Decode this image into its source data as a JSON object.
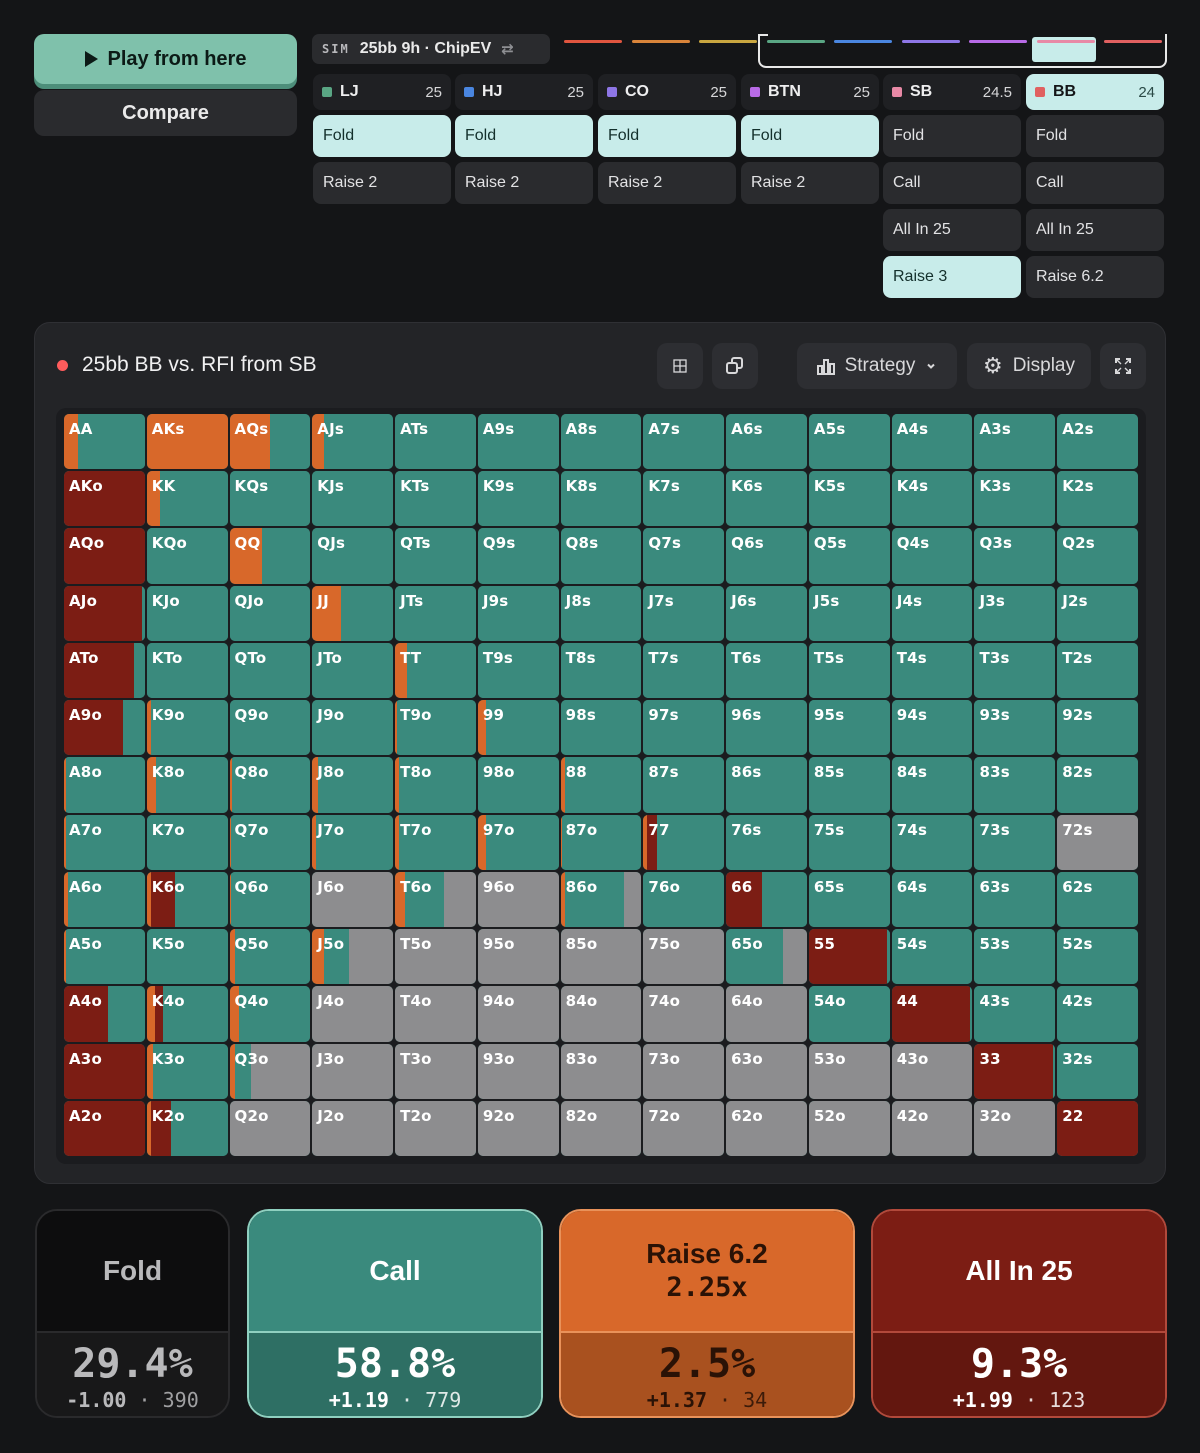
{
  "toolbar": {
    "play_label": "Play from here",
    "compare_label": "Compare"
  },
  "sim": {
    "tag": "SIM",
    "name": "25bb 9h · ChipEV",
    "swap_icon": "swap-icon"
  },
  "colors": {
    "fold": "#8d8d8f",
    "call": "#3a8a7d",
    "raise": "#d8682a",
    "allin": "#7c1d14",
    "active": "#c8ecea"
  },
  "strip_colors": [
    "#e0553f",
    "#d9843a",
    "#c9a640",
    "#5aa684",
    "#4a86e0",
    "#8e76e6",
    "#b86ae6",
    "#e889a6",
    "#e06060"
  ],
  "positions": [
    {
      "id": "lj",
      "name": "LJ",
      "stack": "25",
      "dot": "#5aa684",
      "actions": [
        {
          "label": "Fold",
          "active": true
        },
        {
          "label": "Raise 2",
          "active": false
        }
      ]
    },
    {
      "id": "hj",
      "name": "HJ",
      "stack": "25",
      "dot": "#4a86e0",
      "actions": [
        {
          "label": "Fold",
          "active": true
        },
        {
          "label": "Raise 2",
          "active": false
        }
      ]
    },
    {
      "id": "co",
      "name": "CO",
      "stack": "25",
      "dot": "#8e76e6",
      "actions": [
        {
          "label": "Fold",
          "active": true
        },
        {
          "label": "Raise 2",
          "active": false
        }
      ]
    },
    {
      "id": "btn",
      "name": "BTN",
      "stack": "25",
      "dot": "#b86ae6",
      "actions": [
        {
          "label": "Fold",
          "active": true
        },
        {
          "label": "Raise 2",
          "active": false
        }
      ]
    },
    {
      "id": "sb",
      "name": "SB",
      "stack": "24.5",
      "dot": "#e889a6",
      "actions": [
        {
          "label": "Fold",
          "active": false
        },
        {
          "label": "Call",
          "active": false
        },
        {
          "label": "All In 25",
          "active": false
        },
        {
          "label": "Raise 3",
          "active": true
        }
      ]
    },
    {
      "id": "bb",
      "name": "BB",
      "stack": "24",
      "dot": "#e06060",
      "active": true,
      "actions": [
        {
          "label": "Fold",
          "active": false
        },
        {
          "label": "Call",
          "active": false
        },
        {
          "label": "All In 25",
          "active": false
        },
        {
          "label": "Raise 6.2",
          "active": false
        }
      ]
    }
  ],
  "panel": {
    "title": "25bb BB vs. RFI from SB",
    "strategy_label": "Strategy",
    "display_label": "Display"
  },
  "grid": {
    "labels": [
      [
        "AA",
        "AKs",
        "AQs",
        "AJs",
        "ATs",
        "A9s",
        "A8s",
        "A7s",
        "A6s",
        "A5s",
        "A4s",
        "A3s",
        "A2s"
      ],
      [
        "AKo",
        "KK",
        "KQs",
        "KJs",
        "KTs",
        "K9s",
        "K8s",
        "K7s",
        "K6s",
        "K5s",
        "K4s",
        "K3s",
        "K2s"
      ],
      [
        "AQo",
        "KQo",
        "QQ",
        "QJs",
        "QTs",
        "Q9s",
        "Q8s",
        "Q7s",
        "Q6s",
        "Q5s",
        "Q4s",
        "Q3s",
        "Q2s"
      ],
      [
        "AJo",
        "KJo",
        "QJo",
        "JJ",
        "JTs",
        "J9s",
        "J8s",
        "J7s",
        "J6s",
        "J5s",
        "J4s",
        "J3s",
        "J2s"
      ],
      [
        "ATo",
        "KTo",
        "QTo",
        "JTo",
        "TT",
        "T9s",
        "T8s",
        "T7s",
        "T6s",
        "T5s",
        "T4s",
        "T3s",
        "T2s"
      ],
      [
        "A9o",
        "K9o",
        "Q9o",
        "J9o",
        "T9o",
        "99",
        "98s",
        "97s",
        "96s",
        "95s",
        "94s",
        "93s",
        "92s"
      ],
      [
        "A8o",
        "K8o",
        "Q8o",
        "J8o",
        "T8o",
        "98o",
        "88",
        "87s",
        "86s",
        "85s",
        "84s",
        "83s",
        "82s"
      ],
      [
        "A7o",
        "K7o",
        "Q7o",
        "J7o",
        "T7o",
        "97o",
        "87o",
        "77",
        "76s",
        "75s",
        "74s",
        "73s",
        "72s"
      ],
      [
        "A6o",
        "K6o",
        "Q6o",
        "J6o",
        "T6o",
        "96o",
        "86o",
        "76o",
        "66",
        "65s",
        "64s",
        "63s",
        "62s"
      ],
      [
        "A5o",
        "K5o",
        "Q5o",
        "J5o",
        "T5o",
        "95o",
        "85o",
        "75o",
        "65o",
        "55",
        "54s",
        "53s",
        "52s"
      ],
      [
        "A4o",
        "K4o",
        "Q4o",
        "J4o",
        "T4o",
        "94o",
        "84o",
        "74o",
        "64o",
        "54o",
        "44",
        "43s",
        "42s"
      ],
      [
        "A3o",
        "K3o",
        "Q3o",
        "J3o",
        "T3o",
        "93o",
        "83o",
        "73o",
        "63o",
        "53o",
        "43o",
        "33",
        "32s"
      ],
      [
        "A2o",
        "K2o",
        "Q2o",
        "J2o",
        "T2o",
        "92o",
        "82o",
        "72o",
        "62o",
        "52o",
        "42o",
        "32o",
        "22"
      ]
    ],
    "special": {
      "AA": {
        "r": 0.17,
        "a": 0,
        "c": 0.83
      },
      "AKs": {
        "r": 1,
        "a": 0,
        "c": 0
      },
      "AQs": {
        "r": 0.5,
        "a": 0,
        "c": 0.5
      },
      "AJs": {
        "r": 0.15,
        "a": 0,
        "c": 0.85
      },
      "AKo": {
        "r": 0,
        "a": 1,
        "c": 0
      },
      "KK": {
        "r": 0.17,
        "a": 0,
        "c": 0.83
      },
      "AQo": {
        "r": 0,
        "a": 1,
        "c": 0
      },
      "QQ": {
        "r": 0.4,
        "a": 0,
        "c": 0.6
      },
      "AJo": {
        "r": 0,
        "a": 0.97,
        "c": 0.03
      },
      "JJ": {
        "r": 0.35,
        "a": 0,
        "c": 0.65
      },
      "ATo": {
        "r": 0,
        "a": 0.87,
        "c": 0.13
      },
      "TT": {
        "r": 0.15,
        "a": 0,
        "c": 0.85
      },
      "A9o": {
        "r": 0,
        "a": 0.73,
        "c": 0.27
      },
      "K9o": {
        "r": 0.05,
        "a": 0,
        "c": 0.95
      },
      "T9o": {
        "r": 0.02,
        "a": 0,
        "c": 0.98
      },
      "99": {
        "r": 0.1,
        "a": 0,
        "c": 0.9
      },
      "A8o": {
        "r": 0.03,
        "a": 0,
        "c": 0.97
      },
      "K8o": {
        "r": 0.12,
        "a": 0,
        "c": 0.88
      },
      "Q8o": {
        "r": 0.03,
        "a": 0,
        "c": 0.97
      },
      "J8o": {
        "r": 0.07,
        "a": 0,
        "c": 0.93
      },
      "T8o": {
        "r": 0.05,
        "a": 0,
        "c": 0.95
      },
      "88": {
        "r": 0.05,
        "a": 0,
        "c": 0.95
      },
      "A7o": {
        "r": 0.02,
        "a": 0,
        "c": 0.98
      },
      "Q7o": {
        "r": 0.02,
        "a": 0,
        "c": 0.98
      },
      "J7o": {
        "r": 0.05,
        "a": 0,
        "c": 0.95
      },
      "T7o": {
        "r": 0.05,
        "a": 0,
        "c": 0.95
      },
      "97o": {
        "r": 0.1,
        "a": 0,
        "c": 0.9
      },
      "87o": {
        "r": 0.02,
        "a": 0,
        "c": 0.98
      },
      "77": {
        "r": 0.05,
        "a": 0.12,
        "c": 0.83
      },
      "72s": {
        "r": 0,
        "a": 0,
        "c": 0,
        "f": 1
      },
      "A6o": {
        "r": 0.05,
        "a": 0,
        "c": 0.95
      },
      "K6o": {
        "r": 0.05,
        "a": 0.3,
        "c": 0.65
      },
      "Q6o": {
        "r": 0.02,
        "a": 0,
        "c": 0.98
      },
      "J6o": {
        "r": 0,
        "a": 0,
        "c": 0,
        "f": 1
      },
      "T6o": {
        "r": 0.12,
        "a": 0,
        "c": 0.48,
        "f": 0.4
      },
      "96o": {
        "r": 0,
        "a": 0,
        "c": 0,
        "f": 1
      },
      "86o": {
        "r": 0.05,
        "a": 0,
        "c": 0.73,
        "f": 0.22
      },
      "66": {
        "r": 0,
        "a": 0.45,
        "c": 0.55
      },
      "A5o": {
        "r": 0.02,
        "a": 0,
        "c": 0.98
      },
      "Q5o": {
        "r": 0.07,
        "a": 0,
        "c": 0.93
      },
      "J5o": {
        "r": 0.15,
        "a": 0,
        "c": 0.3,
        "f": 0.55
      },
      "T5o": {
        "r": 0,
        "a": 0,
        "c": 0,
        "f": 1
      },
      "95o": {
        "r": 0,
        "a": 0,
        "c": 0,
        "f": 1
      },
      "85o": {
        "r": 0,
        "a": 0,
        "c": 0,
        "f": 1
      },
      "75o": {
        "r": 0,
        "a": 0,
        "c": 0,
        "f": 1
      },
      "65o": {
        "r": 0,
        "a": 0,
        "c": 0.7,
        "f": 0.3
      },
      "55": {
        "r": 0,
        "a": 0.97,
        "c": 0.03
      },
      "A4o": {
        "r": 0,
        "a": 0.55,
        "c": 0.45
      },
      "K4o": {
        "r": 0.1,
        "a": 0.1,
        "c": 0.8
      },
      "Q4o": {
        "r": 0.12,
        "a": 0,
        "c": 0.88
      },
      "J4o": {
        "r": 0,
        "a": 0,
        "c": 0,
        "f": 1
      },
      "T4o": {
        "r": 0,
        "a": 0,
        "c": 0,
        "f": 1
      },
      "94o": {
        "r": 0,
        "a": 0,
        "c": 0,
        "f": 1
      },
      "84o": {
        "r": 0,
        "a": 0,
        "c": 0,
        "f": 1
      },
      "74o": {
        "r": 0,
        "a": 0,
        "c": 0,
        "f": 1
      },
      "64o": {
        "r": 0,
        "a": 0,
        "c": 0,
        "f": 1
      },
      "44": {
        "r": 0,
        "a": 0.97,
        "c": 0.03
      },
      "A3o": {
        "r": 0,
        "a": 1,
        "c": 0
      },
      "K3o": {
        "r": 0.08,
        "a": 0,
        "c": 0.92
      },
      "Q3o": {
        "r": 0.07,
        "a": 0,
        "c": 0.2,
        "f": 0.73
      },
      "J3o": {
        "r": 0,
        "a": 0,
        "c": 0,
        "f": 1
      },
      "T3o": {
        "r": 0,
        "a": 0,
        "c": 0,
        "f": 1
      },
      "93o": {
        "r": 0,
        "a": 0,
        "c": 0,
        "f": 1
      },
      "83o": {
        "r": 0,
        "a": 0,
        "c": 0,
        "f": 1
      },
      "73o": {
        "r": 0,
        "a": 0,
        "c": 0,
        "f": 1
      },
      "63o": {
        "r": 0,
        "a": 0,
        "c": 0,
        "f": 1
      },
      "53o": {
        "r": 0,
        "a": 0,
        "c": 0,
        "f": 1
      },
      "43o": {
        "r": 0,
        "a": 0,
        "c": 0,
        "f": 1
      },
      "33": {
        "r": 0,
        "a": 0.97,
        "c": 0.03
      },
      "A2o": {
        "r": 0,
        "a": 1,
        "c": 0
      },
      "K2o": {
        "r": 0.05,
        "a": 0.25,
        "c": 0.7
      },
      "Q2o": {
        "r": 0,
        "a": 0,
        "c": 0,
        "f": 1
      },
      "J2o": {
        "r": 0,
        "a": 0,
        "c": 0,
        "f": 1
      },
      "T2o": {
        "r": 0,
        "a": 0,
        "c": 0,
        "f": 1
      },
      "92o": {
        "r": 0,
        "a": 0,
        "c": 0,
        "f": 1
      },
      "82o": {
        "r": 0,
        "a": 0,
        "c": 0,
        "f": 1
      },
      "72o": {
        "r": 0,
        "a": 0,
        "c": 0,
        "f": 1
      },
      "62o": {
        "r": 0,
        "a": 0,
        "c": 0,
        "f": 1
      },
      "52o": {
        "r": 0,
        "a": 0,
        "c": 0,
        "f": 1
      },
      "42o": {
        "r": 0,
        "a": 0,
        "c": 0,
        "f": 1
      },
      "32o": {
        "r": 0,
        "a": 0,
        "c": 0,
        "f": 1
      },
      "22": {
        "r": 0,
        "a": 1,
        "c": 0
      }
    }
  },
  "summary": [
    {
      "id": "fold",
      "title": "Fold",
      "subtitle": "",
      "pct": "29.4%",
      "ev": "-1.00",
      "combos": "390",
      "top": "#0d0d0e",
      "bot": "#181819",
      "border": "#2a2a2c",
      "text": "#b9b9bb"
    },
    {
      "id": "call",
      "title": "Call",
      "subtitle": "",
      "pct": "58.8%",
      "ev": "+1.19",
      "combos": "779",
      "top": "#3a8a7d",
      "bot": "#2e6f64",
      "border": "#8fd0c0",
      "text": "#ffffff"
    },
    {
      "id": "raise",
      "title": "Raise 6.2",
      "subtitle": "2.25x",
      "pct": "2.5%",
      "ev": "+1.37",
      "combos": "34",
      "top": "#d8682a",
      "bot": "#a9511f",
      "border": "#e9925a",
      "text": "#2a1206"
    },
    {
      "id": "allin",
      "title": "All In 25",
      "subtitle": "",
      "pct": "9.3%",
      "ev": "+1.99",
      "combos": "123",
      "top": "#7c1d14",
      "bot": "#63170f",
      "border": "#b2493b",
      "text": "#ffffff"
    }
  ]
}
